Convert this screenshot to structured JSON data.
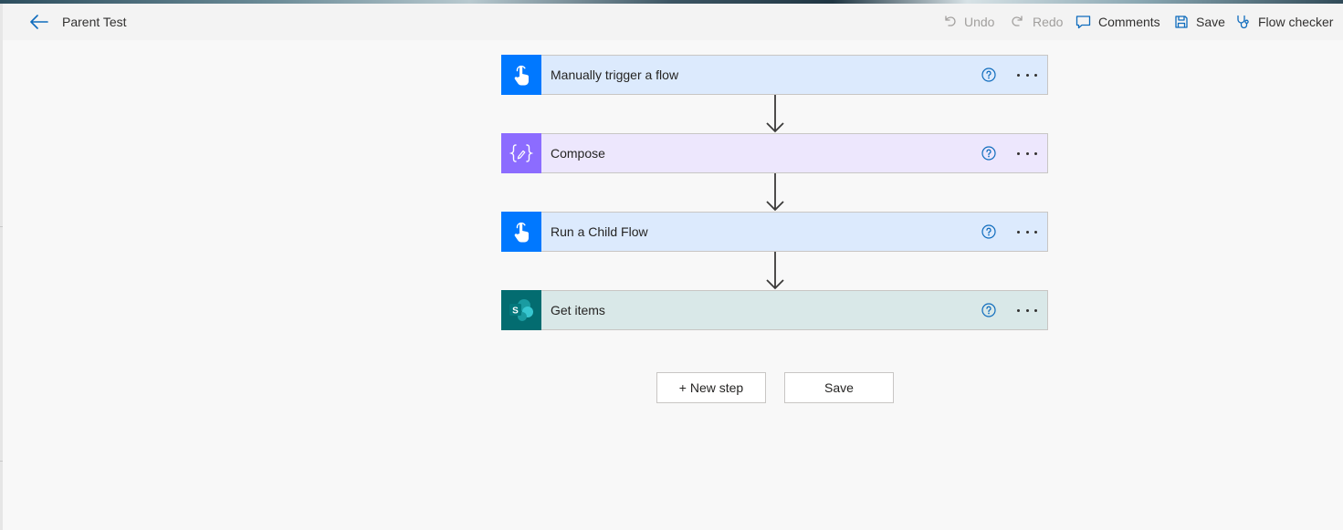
{
  "header": {
    "flow_title": "Parent Test",
    "undo_label": "Undo",
    "redo_label": "Redo",
    "comments_label": "Comments",
    "save_label": "Save",
    "flow_checker_label": "Flow checker"
  },
  "steps": [
    {
      "title": "Manually trigger a flow",
      "icon": "touch-hand-icon",
      "color": "#0078ff",
      "bg": "#dceafd"
    },
    {
      "title": "Compose",
      "icon": "compose-braces-icon",
      "color": "#8c6cff",
      "bg": "#ede7fd"
    },
    {
      "title": "Run a Child Flow",
      "icon": "touch-hand-icon",
      "color": "#0078ff",
      "bg": "#dceafd"
    },
    {
      "title": "Get items",
      "icon": "sharepoint-icon",
      "color": "#036c70",
      "bg": "#d9e8e8"
    }
  ],
  "actions": {
    "new_step_label": "+ New step",
    "save_label": "Save"
  },
  "colors": {
    "accent": "#0f6cbd",
    "help_icon": "#0f6cbd"
  }
}
